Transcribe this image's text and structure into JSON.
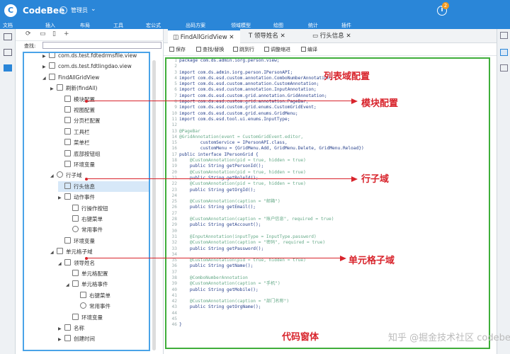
{
  "titlebar": {
    "app_name": "CodeBee",
    "role": "管理员",
    "info_glyph": "i",
    "badge": "2"
  },
  "menu": [
    "文档",
    "插入",
    "布局",
    "工具",
    "宏公式",
    "出码方案",
    "领域模型",
    "绘图",
    "统计",
    "插件"
  ],
  "search": {
    "label": "查找:"
  },
  "tree": [
    {
      "label": "com.ds.test.fdtedrmsfile.view",
      "level": 0,
      "arrow": "▶",
      "icon": "box"
    },
    {
      "label": "com.ds.test.fdtlingdao.view",
      "level": 0,
      "arrow": "▶",
      "icon": "box"
    },
    {
      "label": "FindAllGridView",
      "level": 0,
      "arrow": "◢",
      "icon": "box"
    },
    {
      "label": "刷新(findAll)",
      "level": 1,
      "arrow": "▶",
      "icon": "box"
    },
    {
      "label": "模块配置",
      "level": 2,
      "arrow": "",
      "icon": "box"
    },
    {
      "label": "视图配置",
      "level": 2,
      "arrow": "",
      "icon": "box"
    },
    {
      "label": "分页栏配置",
      "level": 2,
      "arrow": "",
      "icon": "box"
    },
    {
      "label": "工具栏",
      "level": 2,
      "arrow": "",
      "icon": "box"
    },
    {
      "label": "菜单栏",
      "level": 2,
      "arrow": "",
      "icon": "box"
    },
    {
      "label": "底部按钮组",
      "level": 2,
      "arrow": "",
      "icon": "box"
    },
    {
      "label": "环境变量",
      "level": 2,
      "arrow": "",
      "icon": "box"
    },
    {
      "label": "行子域",
      "level": 1,
      "arrow": "◢",
      "icon": "round"
    },
    {
      "label": "行头信息",
      "level": 2,
      "arrow": "",
      "icon": "box",
      "selected": true
    },
    {
      "label": "动作事件",
      "level": 2,
      "arrow": "▶",
      "icon": "box"
    },
    {
      "label": "行操作按钮",
      "level": 3,
      "arrow": "",
      "icon": "box"
    },
    {
      "label": "右键菜单",
      "level": 3,
      "arrow": "",
      "icon": "box"
    },
    {
      "label": "常用事件",
      "level": 3,
      "arrow": "",
      "icon": "round"
    },
    {
      "label": "环境变量",
      "level": 2,
      "arrow": "",
      "icon": "box"
    },
    {
      "label": "单元格子域",
      "level": 1,
      "arrow": "◢",
      "icon": "box"
    },
    {
      "label": "领导姓名",
      "level": 2,
      "arrow": "◢",
      "icon": "box"
    },
    {
      "label": "单元格配置",
      "level": 3,
      "arrow": "",
      "icon": "box"
    },
    {
      "label": "单元格事件",
      "level": 3,
      "arrow": "◢",
      "icon": "box"
    },
    {
      "label": "右键菜单",
      "level": 4,
      "arrow": "",
      "icon": "box"
    },
    {
      "label": "常用事件",
      "level": 4,
      "arrow": "",
      "icon": "round"
    },
    {
      "label": "环境变量",
      "level": 3,
      "arrow": "",
      "icon": "box"
    },
    {
      "label": "名称",
      "level": 2,
      "arrow": "▶",
      "icon": "box"
    },
    {
      "label": "创建时间",
      "level": 2,
      "arrow": "▶",
      "icon": "box"
    }
  ],
  "tabs": [
    {
      "label": "FindAllGridView",
      "close": "✕",
      "icon": "◫",
      "active": true
    },
    {
      "label": "领导姓名",
      "close": "✕",
      "icon": "T",
      "active": false
    },
    {
      "label": "行头信息",
      "close": "✕",
      "icon": "▭",
      "active": false
    }
  ],
  "toolbar": [
    "保存",
    "查找/替换",
    "跳到行",
    "调整缩进",
    "编译"
  ],
  "code": [
    "package com.ds.admin.iorg.person.view;",
    "",
    "import com.ds.admin.iorg.person.IPersonAPI;",
    "import com.ds.esd.custom.annotation.ComboNumberAnnotation;",
    "import com.ds.esd.custom.annotation.CustomAnnotation;",
    "import com.ds.esd.custom.annotation.InputAnnotation;",
    "import com.ds.esd.custom.grid.annotation.GridAnnotation;",
    "import com.ds.esd.custom.grid.annotation.PageBar;",
    "import com.ds.esd.custom.grid.enums.CustomGridEvent;",
    "import com.ds.esd.custom.grid.enums.GridMenu;",
    "import com.ds.esd.tool.ui.enums.InputType;",
    "",
    "@PageBar",
    "@GridAnnotation(event = CustomGridEvent.editor,",
    "        customService = IPersonAPI.class,",
    "        customMenu = {GridMenu.Add, GridMenu.Delete, GridMenu.Reload})",
    "public interface IPersonGrid {",
    "    @CustomAnnotation(pid = true, hidden = true)",
    "    public String getPersonId();",
    "    @CustomAnnotation(pid = true, hidden = true)",
    "    public String getRoleId();",
    "    @CustomAnnotation(pid = true, hidden = true)",
    "    public String getOrgId();",
    "",
    "    @CustomAnnotation(caption = \"邮箱\")",
    "    public String getEmail();",
    "",
    "    @CustomAnnotation(caption = \"账户信息\", required = true)",
    "    public String getAccount();",
    "",
    "    @InputAnnotation(inputType = InputType.password)",
    "    @CustomAnnotation(caption = \"密码\", required = true)",
    "    public String getPassword();",
    "",
    "    @CustomAnnotation(pid = true, hidden = true)",
    "    public String getName();",
    "",
    "    @ComboNumberAnnotation",
    "    @CustomAnnotation(caption = \"手机\")",
    "    public String getMobile();",
    "",
    "    @CustomAnnotation(caption = \"部门名称\")",
    "    public String getOrgName();",
    "",
    "",
    "}"
  ],
  "annotations": {
    "list_config": "列表域配置",
    "module_config": "模块配置",
    "row_domain": "行子域",
    "cell_domain": "单元格子域",
    "code_window": "代码窗体"
  },
  "watermark": "知乎 @掘金技术社区 codebee",
  "colors": {
    "brand": "#2a86d8",
    "annotation": "#d8242c",
    "tree_frame": "#4aa3e8",
    "code_frame": "#3fae3a"
  }
}
